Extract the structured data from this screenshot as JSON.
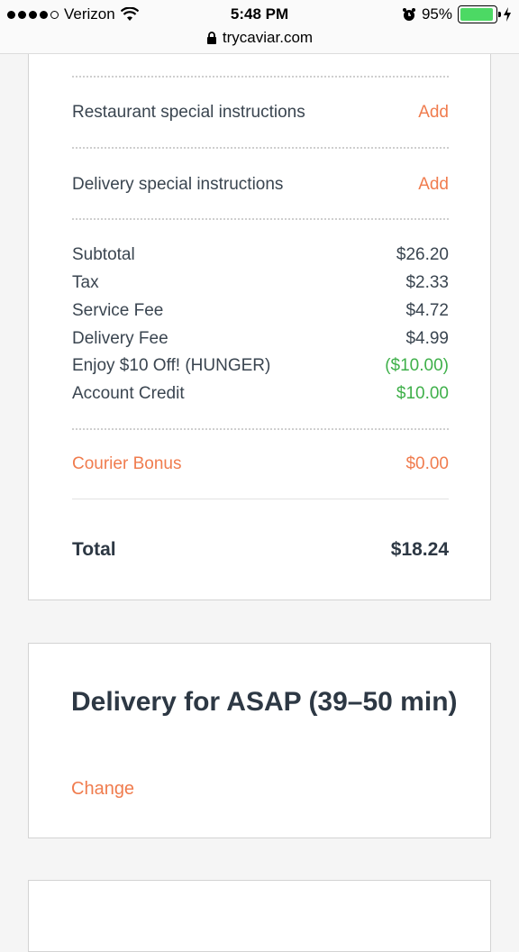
{
  "status_bar": {
    "carrier": "Verizon",
    "time": "5:48 PM",
    "battery_pct": "95%",
    "battery_level": 0.95,
    "url": "trycaviar.com"
  },
  "order": {
    "restaurant_instructions": {
      "label": "Restaurant special instructions",
      "action": "Add"
    },
    "delivery_instructions": {
      "label": "Delivery special instructions",
      "action": "Add"
    },
    "lines": [
      {
        "label": "Subtotal",
        "value": "$26.20"
      },
      {
        "label": "Tax",
        "value": "$2.33"
      },
      {
        "label": "Service Fee",
        "value": "$4.72"
      },
      {
        "label": "Delivery Fee",
        "value": "$4.99"
      },
      {
        "label": "Enjoy $10 Off! (HUNGER)",
        "value": "($10.00)"
      },
      {
        "label": "Account Credit",
        "value": "$10.00"
      }
    ],
    "courier_bonus": {
      "label": "Courier Bonus",
      "value": "$0.00"
    },
    "total": {
      "label": "Total",
      "value": "$18.24"
    }
  },
  "delivery": {
    "title": "Delivery for ASAP (39–50 min)",
    "change_label": "Change"
  },
  "colors": {
    "accent": "#f07c4e",
    "discount": "#3fb04a",
    "text": "#2d3844"
  }
}
